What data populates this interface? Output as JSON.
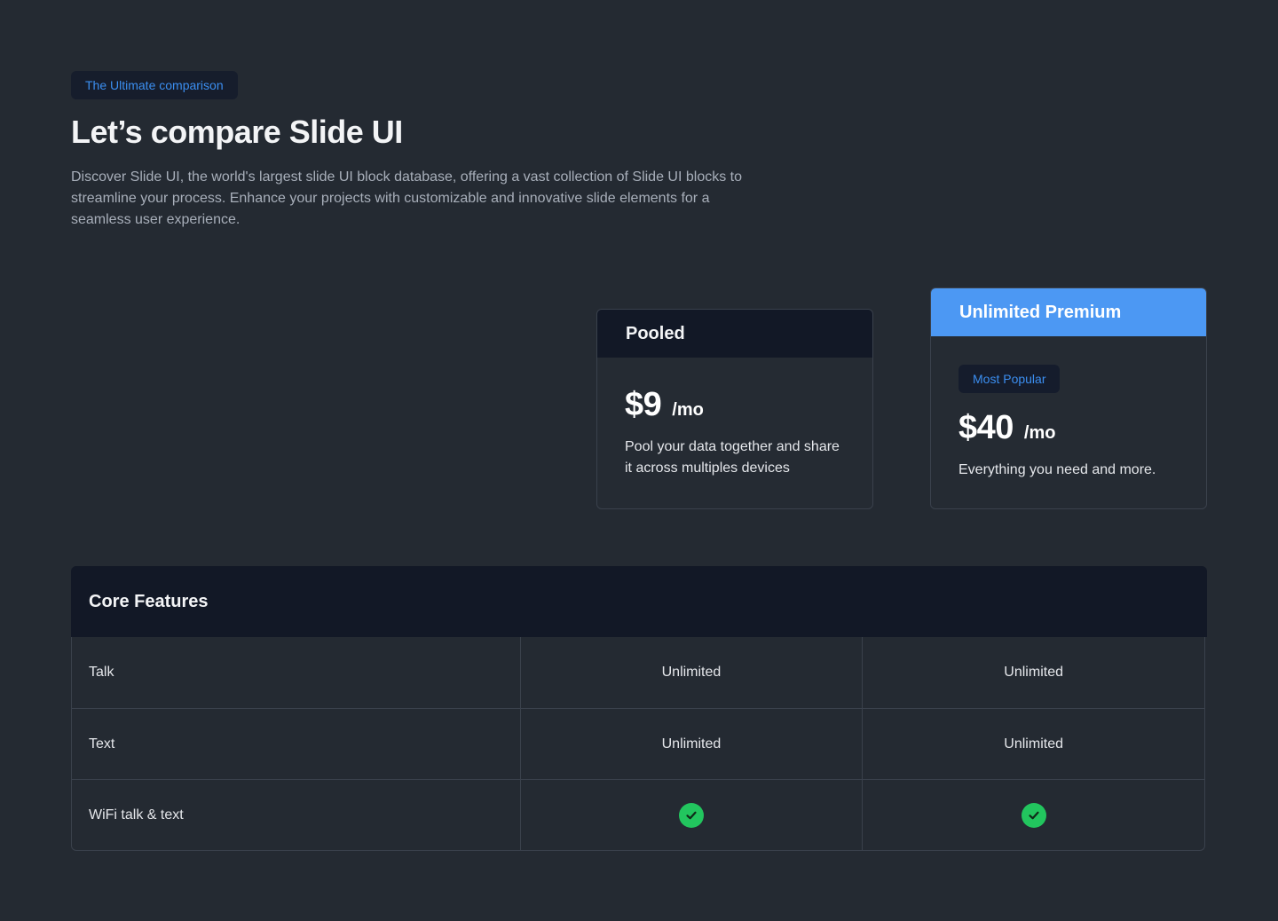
{
  "header": {
    "eyebrow": "The Ultimate comparison",
    "title": "Let’s compare Slide UI",
    "description": "Discover Slide UI, the world's largest slide UI block database, offering a vast collection of Slide UI blocks to streamline your process. Enhance your projects with customizable and innovative slide elements for a seamless user experience."
  },
  "plans": [
    {
      "name": "Pooled",
      "price": "$9",
      "unit": "/mo",
      "description": "Pool your data together and share it across multiples devices"
    },
    {
      "name": "Unlimited Premium",
      "badge": "Most Popular",
      "price": "$40",
      "unit": "/mo",
      "description": "Everything you need and more."
    }
  ],
  "features": {
    "title": "Core Features",
    "rows": [
      {
        "name": "Talk",
        "pooled": "Unlimited",
        "premium": "Unlimited"
      },
      {
        "name": "Text",
        "pooled": "Unlimited",
        "premium": "Unlimited"
      },
      {
        "name": "WiFi talk & text",
        "pooled_icon": "check-circle-icon",
        "premium_icon": "check-circle-icon"
      }
    ]
  },
  "colors": {
    "background": "#242a32",
    "accent": "#4c98f3",
    "check": "#22c55e",
    "panel_dark": "#121826"
  }
}
